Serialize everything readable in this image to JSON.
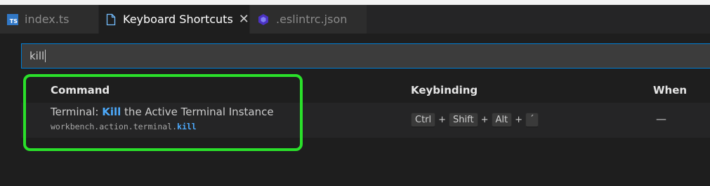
{
  "tabs": [
    {
      "label": "index.ts",
      "icon": "typescript-icon",
      "icon_text": "TS",
      "active": false
    },
    {
      "label": "Keyboard Shortcuts",
      "icon": "document-icon",
      "active": true
    },
    {
      "label": ".eslintrc.json",
      "icon": "eslint-icon",
      "active": false
    }
  ],
  "search": {
    "value": "kill"
  },
  "columns": {
    "command": "Command",
    "keybinding": "Keybinding",
    "when": "When"
  },
  "rows": [
    {
      "title_prefix": "Terminal: ",
      "title_match": "Kill",
      "title_suffix": " the Active Terminal Instance",
      "id_prefix": "workbench.action.terminal.",
      "id_match": "kill",
      "keys": [
        "Ctrl",
        "Shift",
        "Alt",
        "´"
      ],
      "key_separator": "+",
      "when": "—"
    }
  ],
  "colors": {
    "accent": "#007fd4",
    "match_highlight": "#4daafc",
    "annotation": "#2ae02a"
  }
}
